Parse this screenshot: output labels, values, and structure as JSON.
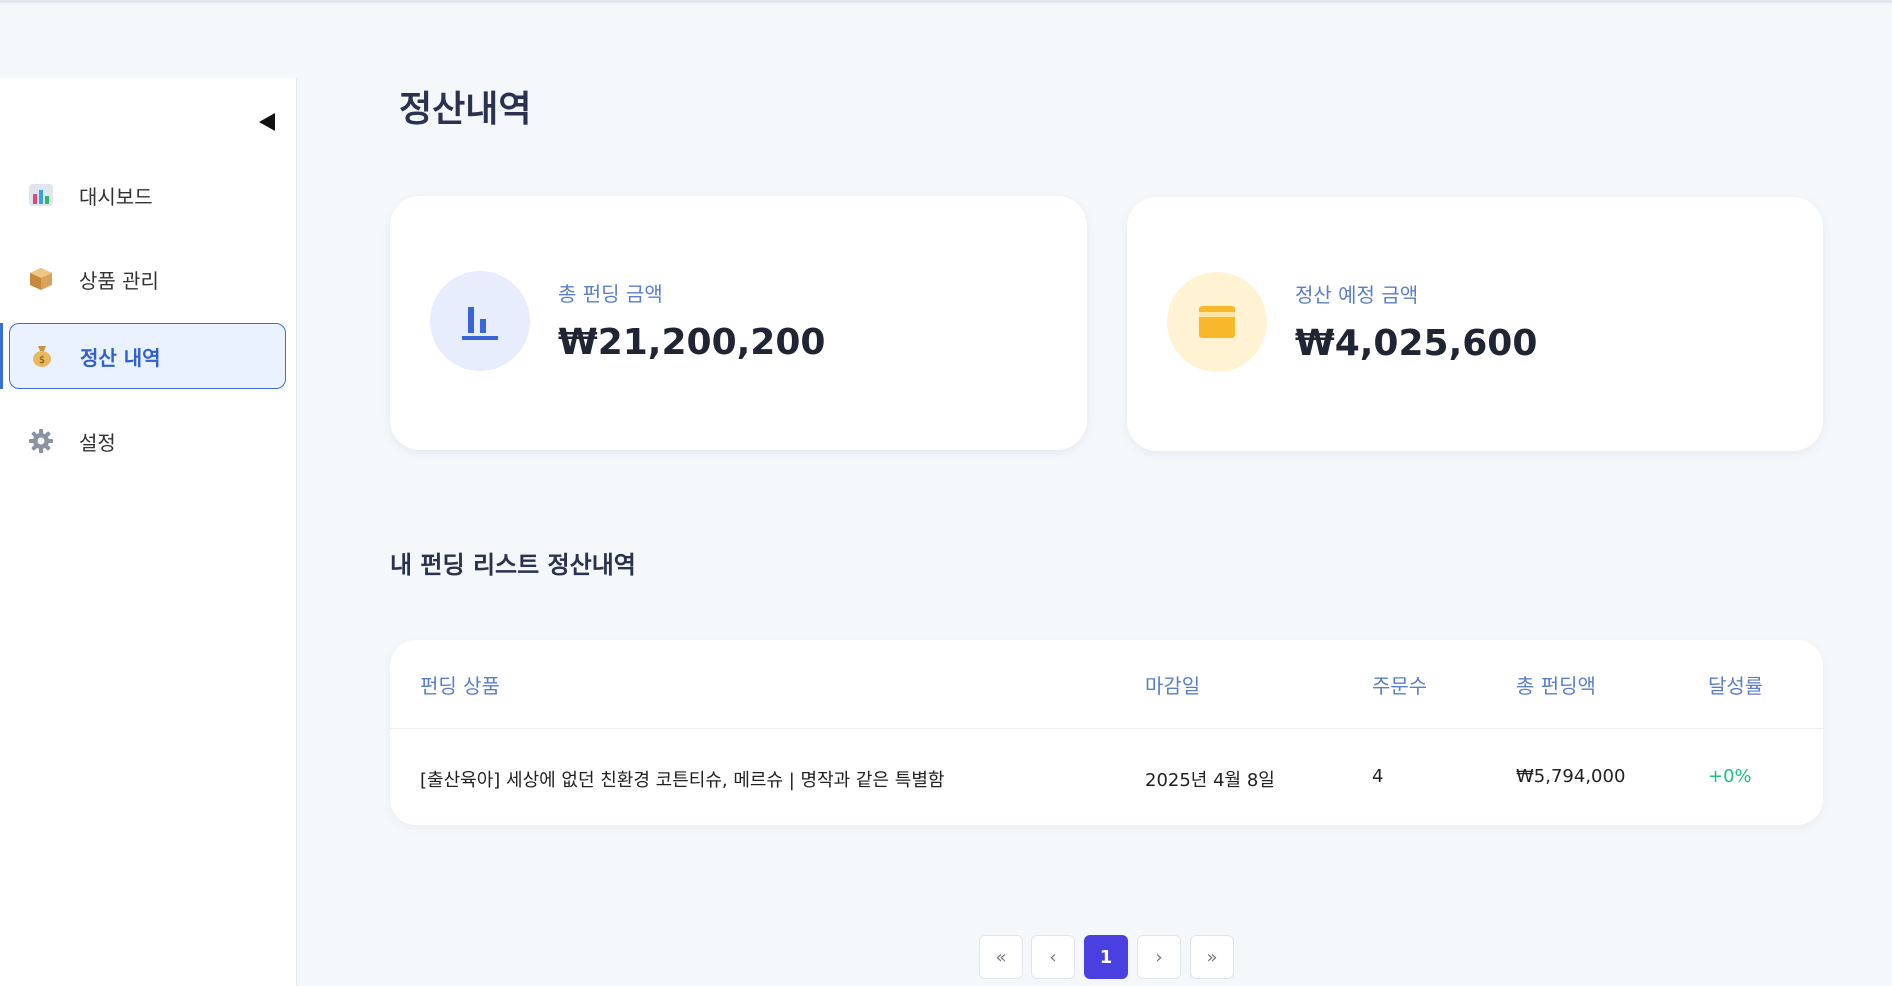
{
  "page": {
    "title": "정산내역"
  },
  "sidebar": {
    "items": [
      {
        "label": "대시보드",
        "icon": "bar-chart-icon",
        "active": false
      },
      {
        "label": "상품 관리",
        "icon": "package-icon",
        "active": false
      },
      {
        "label": "정산 내역",
        "icon": "money-bag-icon",
        "active": true
      },
      {
        "label": "설정",
        "icon": "gear-icon",
        "active": false
      }
    ]
  },
  "stats": {
    "total_funding": {
      "label": "총 펀딩 금액",
      "value": "₩21,200,200",
      "icon": "chart-icon"
    },
    "expected_settlement": {
      "label": "정산 예정 금액",
      "value": "₩4,025,600",
      "icon": "wallet-icon"
    }
  },
  "section": {
    "title": "내 펀딩 리스트 정산내역"
  },
  "table": {
    "headers": [
      "펀딩 상품",
      "마감일",
      "주문수",
      "총 펀딩액",
      "달성률"
    ],
    "rows": [
      [
        "[출산육아] 세상에 없던 친환경 코튼티슈, 메르슈 | 명작과 같은 특별함",
        "2025년 4월 8일",
        "4",
        "₩5,794,000",
        "+0%"
      ]
    ]
  },
  "pagination": {
    "first": "«",
    "prev": "‹",
    "current": "1",
    "next": "›",
    "last": "»"
  },
  "colors": {
    "accent": "#4a3fe0",
    "link_blue": "#2f5fd0",
    "success": "#1fbf7f"
  }
}
